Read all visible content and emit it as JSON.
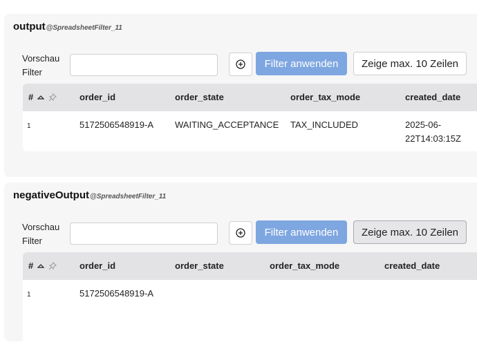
{
  "panels": [
    {
      "title": "output",
      "subtitle": "@SpreadsheetFilter_11",
      "filter_label": "Vorschau Filter",
      "filter_value": "",
      "apply_label": "Filter anwenden",
      "max_rows_label": "Zeige max. 10 Zeilen",
      "columns": [
        "#",
        "order_id",
        "order_state",
        "order_tax_mode",
        "created_date"
      ],
      "rows": [
        {
          "num": "1",
          "order_id": "5172506548919-A",
          "order_state": "WAITING_ACCEPTANCE",
          "order_tax_mode": "TAX_INCLUDED",
          "created_date": "2025-06-22T14:03:15Z"
        }
      ]
    },
    {
      "title": "negativeOutput",
      "subtitle": "@SpreadsheetFilter_11",
      "filter_label": "Vorschau Filter",
      "filter_value": "",
      "apply_label": "Filter anwenden",
      "max_rows_label": "Zeige max. 10 Zeilen",
      "columns": [
        "#",
        "order_id",
        "order_state",
        "order_tax_mode",
        "created_date"
      ],
      "rows": [
        {
          "num": "1",
          "order_id": "5172506548919-A",
          "order_state": "",
          "order_tax_mode": "",
          "created_date": ""
        }
      ]
    }
  ],
  "icons": {
    "add": "plus-circle-icon",
    "sort": "sort-up-icon",
    "pin": "pin-icon"
  },
  "colors": {
    "apply_button": "#7ea6e0",
    "panel_bg": "#f6f6f7",
    "header_bg": "#e3e3e6"
  }
}
